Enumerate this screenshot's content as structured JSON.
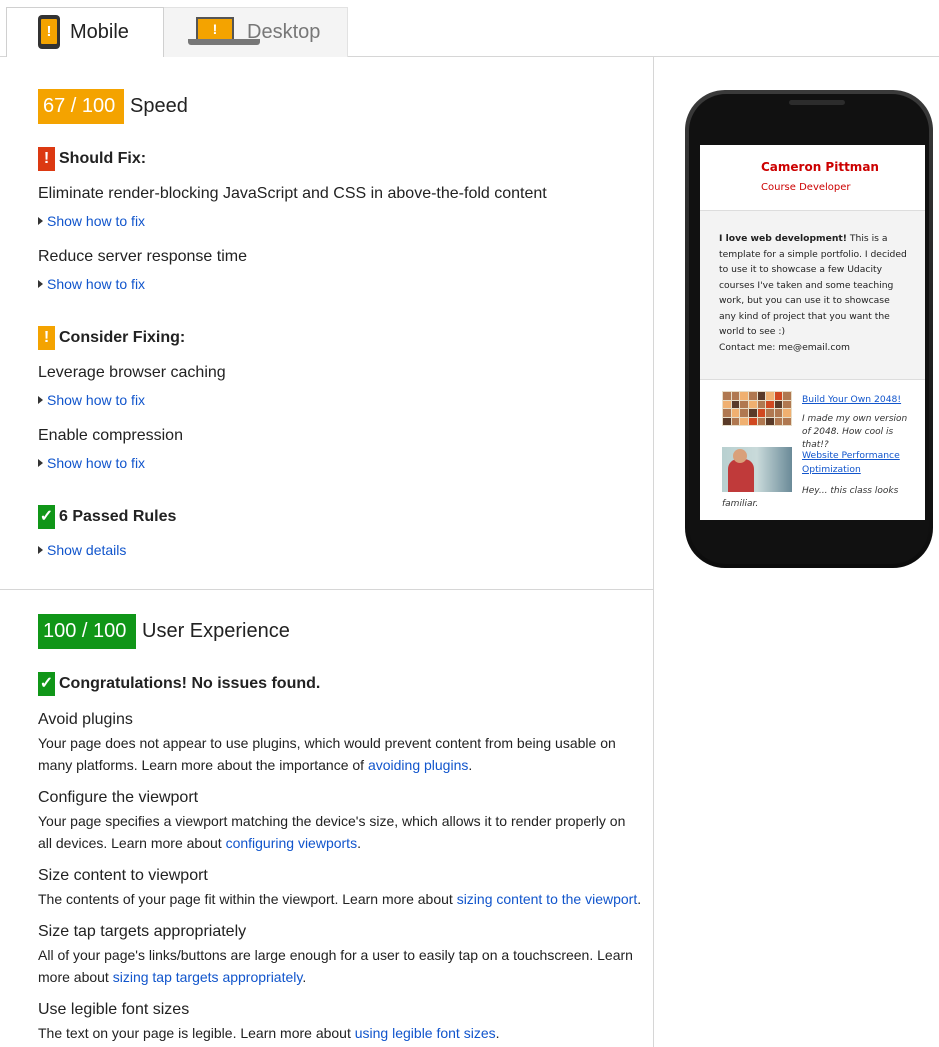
{
  "tabs": {
    "mobile_label": "Mobile",
    "desktop_label": "Desktop",
    "active": "Mobile"
  },
  "speed": {
    "score": "67 / 100",
    "title": "Speed",
    "should_fix": {
      "heading": "Should Fix:",
      "rules": [
        {
          "label": "Eliminate render-blocking JavaScript and CSS in above-the-fold content",
          "link": "Show how to fix"
        },
        {
          "label": "Reduce server response time",
          "link": "Show how to fix"
        }
      ]
    },
    "consider_fixing": {
      "heading": "Consider Fixing:",
      "rules": [
        {
          "label": "Leverage browser caching",
          "link": "Show how to fix"
        },
        {
          "label": "Enable compression",
          "link": "Show how to fix"
        }
      ]
    },
    "passed": {
      "heading": "6 Passed Rules",
      "link": "Show details"
    }
  },
  "ux": {
    "score": "100 / 100",
    "title": "User Experience",
    "congrats": "Congratulations! No issues found.",
    "items": [
      {
        "title": "Avoid plugins",
        "text": "Your page does not appear to use plugins, which would prevent content from being usable on many platforms. Learn more about the importance of ",
        "link": "avoiding plugins",
        "end": "."
      },
      {
        "title": "Configure the viewport",
        "text": "Your page specifies a viewport matching the device's size, which allows it to render properly on all devices. Learn more about ",
        "link": "configuring viewports",
        "end": "."
      },
      {
        "title": "Size content to viewport",
        "text": "The contents of your page fit within the viewport. Learn more about ",
        "link": "sizing content to the viewport",
        "end": "."
      },
      {
        "title": "Size tap targets appropriately",
        "text": "All of your page's links/buttons are large enough for a user to easily tap on a touchscreen. Learn more about ",
        "link": "sizing tap targets appropriately",
        "end": "."
      },
      {
        "title": "Use legible font sizes",
        "text": "The text on your page is legible. Learn more about ",
        "link": "using legible font sizes",
        "end": "."
      }
    ]
  },
  "preview": {
    "name": "Cameron Pittman",
    "role": "Course Developer",
    "about_bold": "I love web development!",
    "about_text": " This is a template for a simple portfolio. I decided to use it to showcase a few Udacity courses I've taken and some teaching work, but you can use it to showcase any kind of project that you want the world to see :)",
    "contact": "Contact me: me@email.com",
    "projects": [
      {
        "title": "Build Your Own 2048!",
        "desc": "I made my own version of 2048. How cool is that!?"
      },
      {
        "title": "Website Performance Optimization",
        "desc": "Hey... this class looks familiar."
      }
    ]
  },
  "colors": {
    "score_orange": "#f4a300",
    "score_green": "#109618",
    "should_fix_red": "#dc3912",
    "link_blue": "#1155cc"
  }
}
